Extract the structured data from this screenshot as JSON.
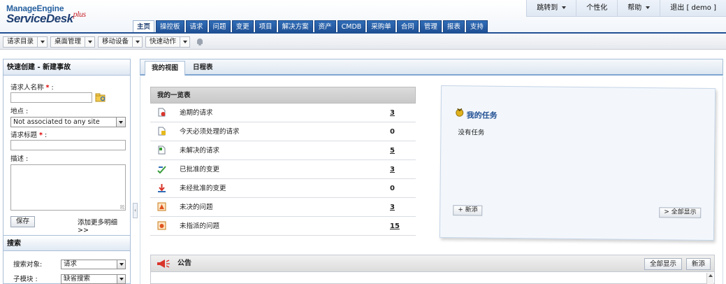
{
  "logo": {
    "line1_a": "Manage",
    "line1_b": "Engine",
    "line2": "ServiceDesk",
    "plus": "plus"
  },
  "top_links": [
    {
      "label": "跳转到",
      "dropdown": true
    },
    {
      "label": "个性化",
      "dropdown": false
    },
    {
      "label": "帮助",
      "dropdown": true
    },
    {
      "label": "退出 [ demo ]",
      "dropdown": false
    }
  ],
  "main_tabs": [
    "主页",
    "操控板",
    "请求",
    "问题",
    "变更",
    "项目",
    "解决方案",
    "资产",
    "CMDB",
    "采购单",
    "合同",
    "管理",
    "报表",
    "支持"
  ],
  "active_main_tab": "主页",
  "toolbar": {
    "items": [
      "请求目录",
      "桌面管理",
      "移动设备",
      "快速动作"
    ],
    "icon": "bell-icon"
  },
  "quick_create": {
    "title": "快速创建 - 新建事故",
    "requester_label": "请求人名称",
    "site_label": "地点 :",
    "site_value": "Not associated to any site",
    "subject_label": "请求标题",
    "description_label": "描述 :",
    "required_mark": "*",
    "colon": ":",
    "save_label": "保存",
    "more_details": "添加更多明细 >>"
  },
  "search": {
    "title": "搜索",
    "target_label": "搜索对象:",
    "target_value": "请求",
    "module_label": "子模块 :",
    "module_value": "缺省搜索"
  },
  "content_tabs": [
    "我的视图",
    "日程表"
  ],
  "summary": {
    "title": "我的一览表",
    "rows": [
      {
        "label": "逾期的请求",
        "count": "3",
        "link": true,
        "icon": "overdue-request-icon"
      },
      {
        "label": "今天必须处理的请求",
        "count": "0",
        "link": false,
        "icon": "due-today-request-icon"
      },
      {
        "label": "未解决的请求",
        "count": "5",
        "link": true,
        "icon": "pending-request-icon"
      },
      {
        "label": "已批准的变更",
        "count": "3",
        "link": true,
        "icon": "approved-change-icon"
      },
      {
        "label": "未经批准的变更",
        "count": "0",
        "link": false,
        "icon": "unapproved-change-icon"
      },
      {
        "label": "未决的问题",
        "count": "3",
        "link": true,
        "icon": "open-problem-icon"
      },
      {
        "label": "未指派的问题",
        "count": "15",
        "link": true,
        "icon": "unassigned-problem-icon"
      }
    ]
  },
  "tasks": {
    "title": "我的任务",
    "empty_text": "没有任务",
    "add_label": "+ 新添",
    "show_all_label": "> 全部显示"
  },
  "announcements": {
    "title": "公告",
    "show_all_label": "全部显示",
    "add_label": "新添"
  },
  "colors": {
    "nav": "#1f4f93",
    "accent": "#27619f",
    "required": "#dd0000"
  }
}
